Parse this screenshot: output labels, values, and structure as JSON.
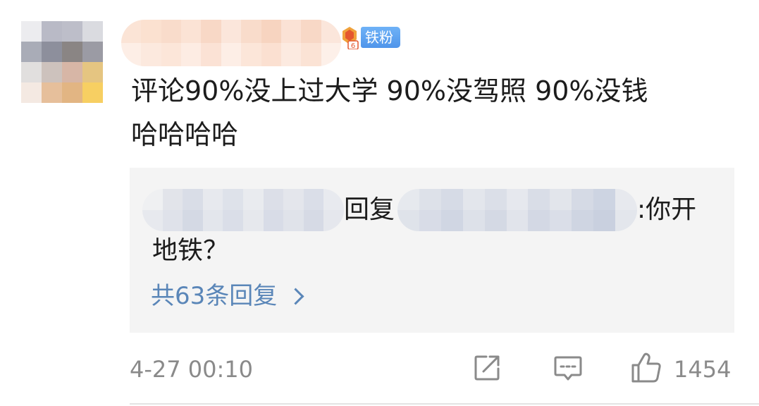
{
  "comment": {
    "fan_badge": "铁粉",
    "text_line1": "评论90%没上过大学 90%没驾照 90%没钱",
    "text_line2": "哈哈哈哈"
  },
  "reply_preview": {
    "reply_word": "回复",
    "text_after_name": ":你开",
    "text_line2": "地铁？",
    "more_replies": "共63条回复"
  },
  "footer": {
    "timestamp": "4-27 00:10",
    "like_count": "1454"
  },
  "icons": {
    "share": "share-icon",
    "comment": "comment-icon",
    "like": "like-icon",
    "chevron": "chevron-right-icon"
  },
  "colors": {
    "link": "#5a86b8",
    "reply_background": "#f4f4f4",
    "fan_badge": "#4f95ea",
    "meta_text": "#8a8a8a"
  }
}
